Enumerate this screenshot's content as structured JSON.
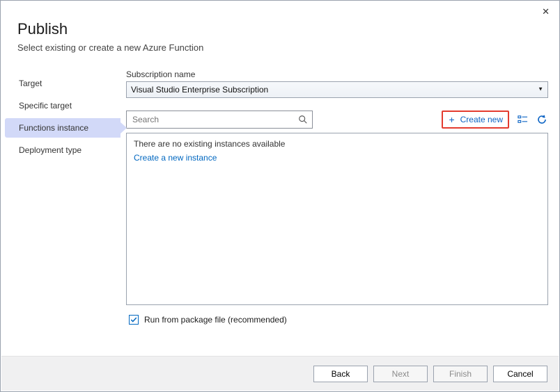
{
  "header": {
    "title": "Publish",
    "subtitle": "Select existing or create a new Azure Function"
  },
  "sidebar": {
    "items": [
      {
        "label": "Target",
        "selected": false
      },
      {
        "label": "Specific target",
        "selected": false
      },
      {
        "label": "Functions instance",
        "selected": true
      },
      {
        "label": "Deployment type",
        "selected": false
      }
    ]
  },
  "subscription": {
    "label": "Subscription name",
    "value": "Visual Studio Enterprise Subscription"
  },
  "search": {
    "placeholder": "Search"
  },
  "actions": {
    "create_new": "Create new",
    "resource_view_tooltip": "Resource view",
    "refresh_tooltip": "Refresh"
  },
  "list": {
    "empty_text": "There are no existing instances available",
    "create_link": "Create a new instance"
  },
  "run_from_package": {
    "label": "Run from package file (recommended)",
    "checked": true
  },
  "footer": {
    "back": "Back",
    "next": "Next",
    "finish": "Finish",
    "cancel": "Cancel"
  }
}
